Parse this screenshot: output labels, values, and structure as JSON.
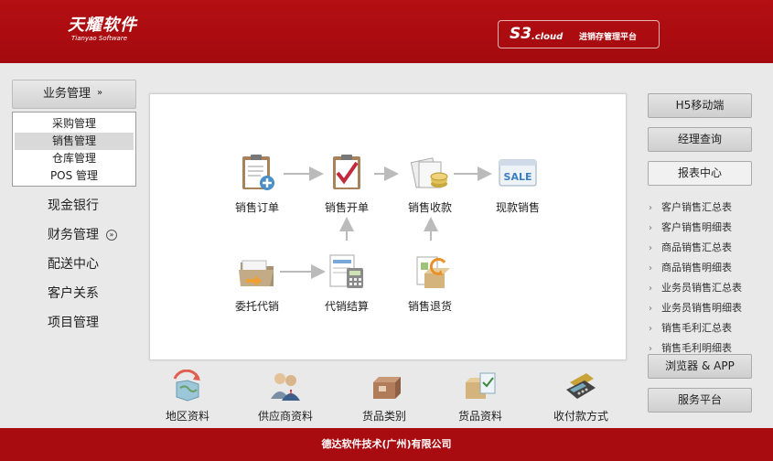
{
  "header": {
    "logo_main": "天耀软件",
    "logo_sub": "Tianyao Software",
    "badge_s3": "S3",
    "badge_cloud": "cloud",
    "badge_text": "进销存管理平台"
  },
  "left_nav": {
    "group_title": "业务管理",
    "sub_items": [
      "采购管理",
      "销售管理",
      "仓库管理",
      "POS 管理"
    ],
    "active_sub": "销售管理",
    "items": [
      "现金银行",
      "财务管理",
      "配送中心",
      "客户关系",
      "项目管理"
    ]
  },
  "flow": {
    "sales_order": "销售订单",
    "sales_invoice": "销售开单",
    "sales_receipt": "销售收款",
    "cash_sales": "现款销售",
    "consignment": "委托代销",
    "consign_settle": "代销结算",
    "sales_return": "销售退货",
    "sale_tag": "SALE"
  },
  "bottom": [
    "地区资料",
    "供应商资料",
    "货品类别",
    "货品资料",
    "收付款方式"
  ],
  "right": {
    "h5": "H5移动端",
    "manager": "经理查询",
    "report_center": "报表中心",
    "reports": [
      "客户销售汇总表",
      "客户销售明细表",
      "商品销售汇总表",
      "商品销售明细表",
      "业务员销售汇总表",
      "业务员销售明细表",
      "销售毛利汇总表",
      "销售毛利明细表"
    ],
    "browser_app": "浏览器 & APP",
    "service": "服务平台"
  },
  "footer": {
    "company": "德达软件技术(广州)有限公司"
  },
  "colors": {
    "brand_red": "#a90c10",
    "panel_bg": "#ffffff",
    "page_bg": "#e9e9e9"
  }
}
